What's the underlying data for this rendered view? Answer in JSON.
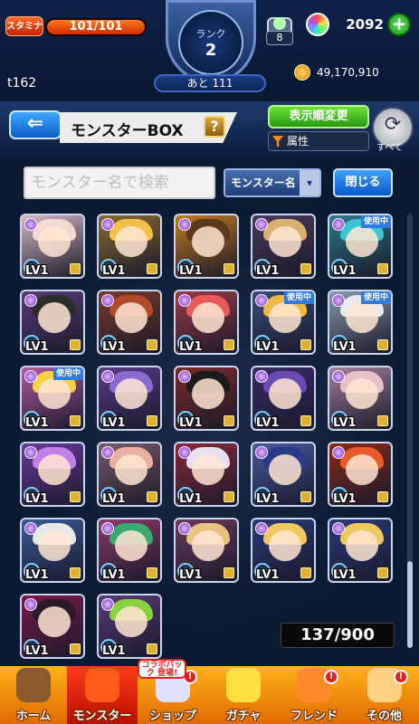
{
  "status": {
    "stamina_label": "スタミナ",
    "stamina": "101/101",
    "stamina_fraction": 1.0,
    "rank_label": "ランク",
    "rank": "2",
    "rank_next": "あと 111",
    "orb_count": "8",
    "gem_count": "2092",
    "gem_add": "+",
    "player_id": "t162",
    "gold": "49,170,910"
  },
  "header": {
    "back_arrow": "⇐",
    "title": "モンスターBOX",
    "help": "?",
    "sort_label": "表示順変更",
    "filter_label": "属性",
    "all_icon": "⟳",
    "all_label": "すべて"
  },
  "search": {
    "placeholder": "モンスター名で検索",
    "select_value": "モンスター名",
    "select_arrow": "▾",
    "close_label": "閉じる"
  },
  "monsters": [
    {
      "level": "LV1",
      "in_use": "",
      "hair": "#f3d9d0",
      "bg": "#d7b9c7"
    },
    {
      "level": "LV1",
      "in_use": "",
      "hair": "#f2c04a",
      "bg": "#8a6a30"
    },
    {
      "level": "LV1",
      "in_use": "",
      "hair": "#5a3a1a",
      "bg": "#c07a20"
    },
    {
      "level": "LV1",
      "in_use": "",
      "hair": "#d8b070",
      "bg": "#4a3a5a"
    },
    {
      "level": "LV1",
      "in_use": "使用中",
      "hair": "#39c6d2",
      "bg": "#2a7a8a"
    },
    {
      "level": "LV1",
      "in_use": "",
      "hair": "#2c2c2c",
      "bg": "#5a3a7a"
    },
    {
      "level": "LV1",
      "in_use": "",
      "hair": "#b04a2a",
      "bg": "#7a3a2a"
    },
    {
      "level": "LV1",
      "in_use": "",
      "hair": "#e85a5a",
      "bg": "#9a3a4a"
    },
    {
      "level": "LV1",
      "in_use": "使用中",
      "hair": "#f0b840",
      "bg": "#3a4a7a"
    },
    {
      "level": "LV1",
      "in_use": "使用中",
      "hair": "#e8e8f0",
      "bg": "#8a9ab0"
    },
    {
      "level": "LV1",
      "in_use": "使用中",
      "hair": "#f7d04a",
      "bg": "#b05aa0"
    },
    {
      "level": "LV1",
      "in_use": "",
      "hair": "#8a6ad0",
      "bg": "#5a3a8a"
    },
    {
      "level": "LV1",
      "in_use": "",
      "hair": "#1a1a1a",
      "bg": "#7a2a2a"
    },
    {
      "level": "LV1",
      "in_use": "",
      "hair": "#6a4ab0",
      "bg": "#3a2a6a"
    },
    {
      "level": "LV1",
      "in_use": "",
      "hair": "#e8c0c8",
      "bg": "#a0809a"
    },
    {
      "level": "LV1",
      "in_use": "",
      "hair": "#c080e8",
      "bg": "#6a3a9a"
    },
    {
      "level": "LV1",
      "in_use": "",
      "hair": "#e8b0a0",
      "bg": "#7a5a6a"
    },
    {
      "level": "LV1",
      "in_use": "",
      "hair": "#e8e0f0",
      "bg": "#8a2a3a"
    },
    {
      "level": "LV1",
      "in_use": "",
      "hair": "#2a3a8a",
      "bg": "#4a5aa0"
    },
    {
      "level": "LV1",
      "in_use": "",
      "hair": "#e85a2a",
      "bg": "#8a2a1a"
    },
    {
      "level": "LV1",
      "in_use": "",
      "hair": "#e8e8e8",
      "bg": "#3a5a9a"
    },
    {
      "level": "LV1",
      "in_use": "",
      "hair": "#3aa870",
      "bg": "#8a3a6a"
    },
    {
      "level": "LV1",
      "in_use": "",
      "hair": "#e8c080",
      "bg": "#6a3a5a"
    },
    {
      "level": "LV1",
      "in_use": "",
      "hair": "#f0c860",
      "bg": "#2a3a7a"
    },
    {
      "level": "LV1",
      "in_use": "",
      "hair": "#f0c860",
      "bg": "#2a3a7a"
    },
    {
      "level": "LV1",
      "in_use": "",
      "hair": "#2a1a2a",
      "bg": "#7a1a4a"
    },
    {
      "level": "LV1",
      "in_use": "",
      "hair": "#8ad040",
      "bg": "#5a3a7a"
    }
  ],
  "box_count": "137/900",
  "nav": {
    "items": [
      {
        "label": "ホーム",
        "icon_color": "#8a5a2a",
        "badge": ""
      },
      {
        "label": "モンスター",
        "icon_color": "#ff5a1a",
        "badge": ""
      },
      {
        "label": "ショップ",
        "icon_color": "#e0e0ff",
        "badge": "!"
      },
      {
        "label": "ガチャ",
        "icon_color": "#ffe040",
        "badge": ""
      },
      {
        "label": "フレンド",
        "icon_color": "#ff8a2a",
        "badge": "!"
      },
      {
        "label": "その他",
        "icon_color": "#ffd080",
        "badge": "!"
      }
    ],
    "collab_badge": "コラボパック 登場!"
  }
}
